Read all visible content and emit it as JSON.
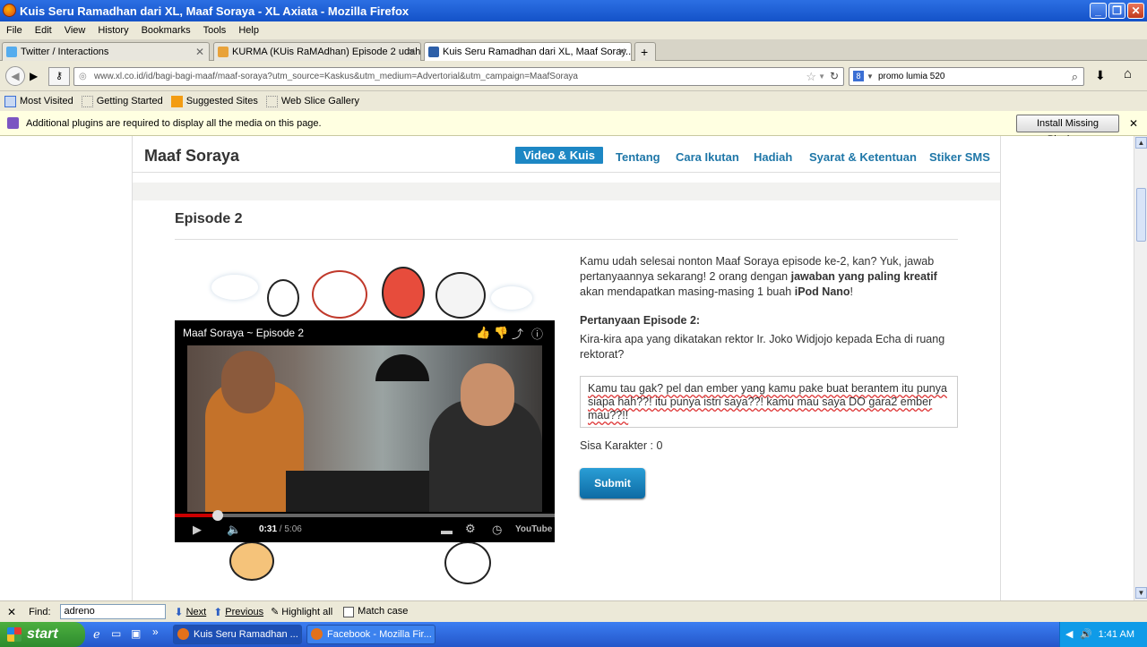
{
  "window": {
    "title": "Kuis Seru Ramadhan dari XL, Maaf Soraya - XL Axiata - Mozilla Firefox"
  },
  "menu": [
    "File",
    "Edit",
    "View",
    "History",
    "Bookmarks",
    "Tools",
    "Help"
  ],
  "tabs": [
    {
      "label": "Twitter / Interactions"
    },
    {
      "label": "KURMA (KUis RaMAdhan) Episode 2 udah..."
    },
    {
      "label": "Kuis Seru Ramadhan dari XL, Maaf Soray..."
    }
  ],
  "nav": {
    "url": "www.xl.co.id/id/bagi-bagi-maaf/maaf-soraya?utm_source=Kaskus&utm_medium=Advertorial&utm_campaign=MaafSoraya",
    "search_value": "promo lumia 520"
  },
  "bookmarks": [
    "Most Visited",
    "Getting Started",
    "Suggested Sites",
    "Web Slice Gallery"
  ],
  "plugin": {
    "message": "Additional plugins are required to display all the media on this page.",
    "button": "Install Missing Plugins..."
  },
  "site": {
    "brand": "Maaf Soraya",
    "nav": [
      "Video & Kuis",
      "Tentang",
      "Cara Ikutan",
      "Hadiah",
      "Syarat & Ketentuan",
      "Stiker SMS"
    ],
    "episode_title": "Episode 2",
    "desc_part1": "Kamu udah selesai nonton Maaf Soraya episode ke-2, kan? Yuk, jawab pertanyaannya sekarang! 2 orang dengan ",
    "desc_bold1": "jawaban yang paling kreatif",
    "desc_part2": " akan mendapatkan masing-masing 1 buah ",
    "desc_bold2": "iPod Nano",
    "desc_part3": "!",
    "question_title": "Pertanyaan Episode 2:",
    "question_text": "Kira-kira apa yang dikatakan rektor Ir. Joko Widjojo kepada Echa di ruang rektorat?",
    "answer": "Kamu tau gak? pel dan ember yang kamu pake buat berantem itu punya siapa hah??! itu punya istri saya??! kamu mau saya DO gara2 ember mau??!!",
    "sisa": "Sisa Karakter : 0",
    "submit": "Submit"
  },
  "video": {
    "title": "Maaf Soraya ~ Episode 2",
    "current": "0:31",
    "duration": "/ 5:06",
    "progress": 0.1,
    "brand": "YouTube"
  },
  "find": {
    "label": "Find:",
    "value": "adreno",
    "next": "Next",
    "previous": "Previous",
    "highlight": "Highlight all",
    "match": "Match case"
  },
  "taskbar": {
    "start": "start",
    "tasks": [
      "Kuis Seru Ramadhan ...",
      "Facebook - Mozilla Fir..."
    ],
    "clock": "1:41 AM"
  },
  "colors": {
    "accent": "#1d87c4",
    "nav_text": "#1f77a8",
    "submit": "#1479b5"
  }
}
